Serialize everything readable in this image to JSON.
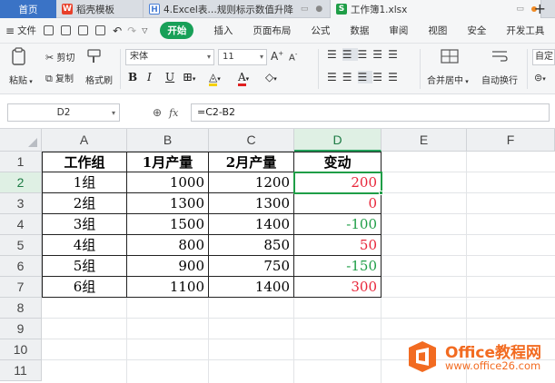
{
  "tabs": {
    "home": "首页",
    "items": [
      {
        "label": "稻壳模板",
        "icon": "wps-logo-icon",
        "color": "#e8402a"
      },
      {
        "label": "4.Excel表…规则标示数值升降",
        "icon": "document-icon",
        "color": "#4a7fd6"
      },
      {
        "label": "工作簿1.xlsx",
        "icon": "spreadsheet-icon",
        "color": "#1f9e47"
      }
    ],
    "new_tab": "+"
  },
  "menubar": {
    "file": "文件",
    "start": "开始",
    "items": [
      "插入",
      "页面布局",
      "公式",
      "数据",
      "审阅",
      "视图",
      "安全",
      "开发工具"
    ]
  },
  "ribbon": {
    "cut": "剪切",
    "copy": "复制",
    "format_painter": "格式刷",
    "paste": "粘贴",
    "font": "宋体",
    "font_size": "11",
    "merge": "合并居中",
    "wrap": "自动换行",
    "custom": "自定"
  },
  "formula_bar": {
    "name_box": "D2",
    "fx": "fx",
    "formula": "=C2-B2"
  },
  "sheet": {
    "columns": [
      "A",
      "B",
      "C",
      "D",
      "E",
      "F"
    ],
    "rows": [
      "1",
      "2",
      "3",
      "4",
      "5",
      "6",
      "7",
      "8",
      "9",
      "10",
      "11"
    ],
    "selected_column": "D",
    "selected_row": "2",
    "header": [
      "工作组",
      "1月产量",
      "2月产量",
      "变动"
    ],
    "data": [
      [
        "1组",
        "1000",
        "1200",
        "200"
      ],
      [
        "2组",
        "1300",
        "1300",
        "0"
      ],
      [
        "3组",
        "1500",
        "1400",
        "-100"
      ],
      [
        "4组",
        "800",
        "850",
        "50"
      ],
      [
        "5组",
        "900",
        "750",
        "-150"
      ],
      [
        "6组",
        "1100",
        "1400",
        "300"
      ]
    ],
    "change_colors": [
      "red",
      "red",
      "green",
      "red",
      "green",
      "red"
    ],
    "colors": {
      "positive": "#e8263a",
      "negative": "#1f9e47"
    }
  },
  "watermark": {
    "title": "Office教程网",
    "url": "www.office26.com"
  }
}
